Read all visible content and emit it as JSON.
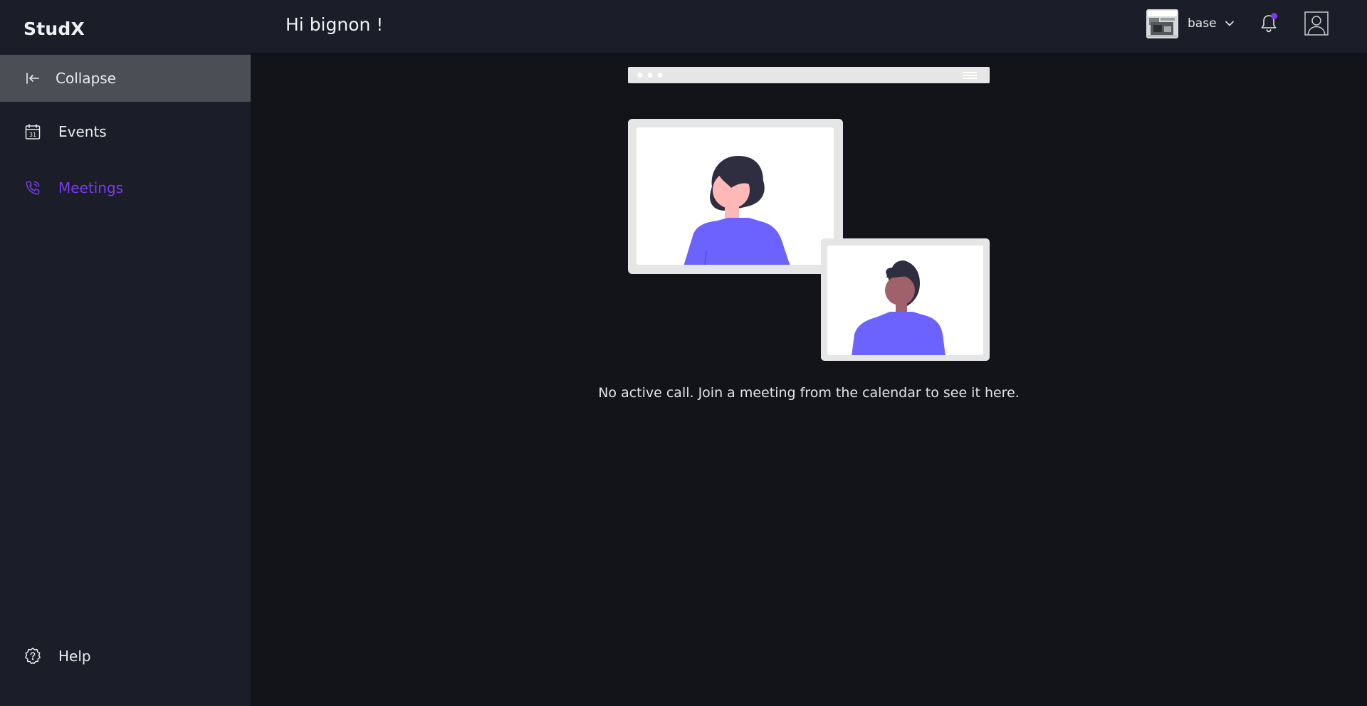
{
  "app": {
    "name": "StudX"
  },
  "sidebar": {
    "collapse_label": "Collapse",
    "items": [
      {
        "label": "Events",
        "icon": "calendar-icon"
      },
      {
        "label": "Meetings",
        "icon": "phone-icon",
        "active": true
      }
    ],
    "help_label": "Help",
    "calendar_icon_text": "31"
  },
  "header": {
    "greeting": "Hi bignon !",
    "workspace": {
      "name": "base",
      "icon": "chevron-down-icon"
    },
    "notifications": {
      "icon": "bell-icon",
      "has_unread": true
    },
    "profile": {
      "icon": "user-icon"
    }
  },
  "main": {
    "empty_message": "No active call. Join a meeting from the calendar to see it here."
  },
  "colors": {
    "accent": "#7c3aed",
    "sidebar_bg": "#1b1e28",
    "main_bg": "#131419",
    "active_collapse_bg": "#4b4f55",
    "illustration_purple": "#6c63ff"
  }
}
